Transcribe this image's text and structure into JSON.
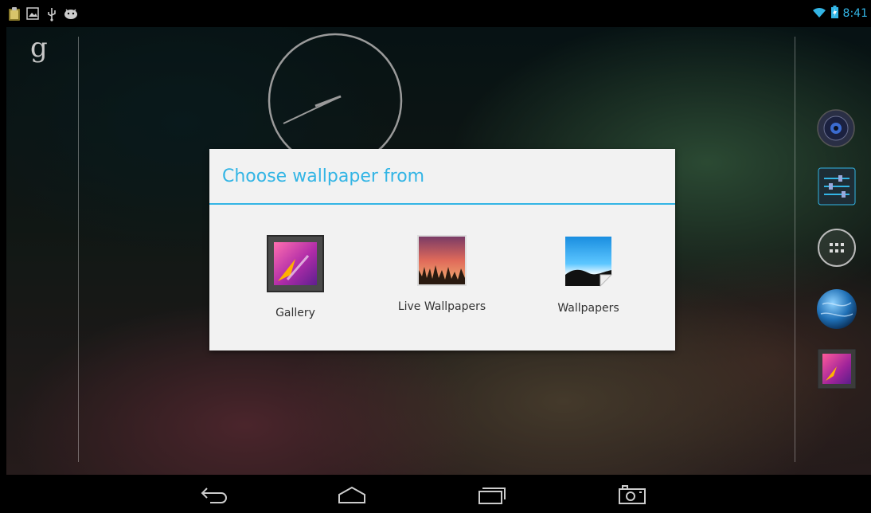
{
  "status_bar": {
    "time": "8:41",
    "left_icons": [
      "clipboard-notification-icon",
      "image-notification-icon",
      "usb-icon",
      "android-debug-icon"
    ],
    "right_icons": [
      "wifi-icon",
      "battery-charging-icon"
    ],
    "accent_color": "#33b5e5"
  },
  "home": {
    "search_logo": "g",
    "dock_icons": [
      "music-icon",
      "settings-icon",
      "all-apps-icon",
      "browser-globe-icon",
      "gallery-icon"
    ]
  },
  "dialog": {
    "title": "Choose wallpaper from",
    "options": [
      {
        "label": "Gallery",
        "icon": "gallery-icon"
      },
      {
        "label": "Live Wallpapers",
        "icon": "live-wallpapers-icon"
      },
      {
        "label": "Wallpapers",
        "icon": "wallpapers-icon"
      }
    ]
  },
  "nav_bar": {
    "buttons": [
      "back-icon",
      "home-icon",
      "recent-apps-icon",
      "screenshot-camera-icon"
    ]
  }
}
